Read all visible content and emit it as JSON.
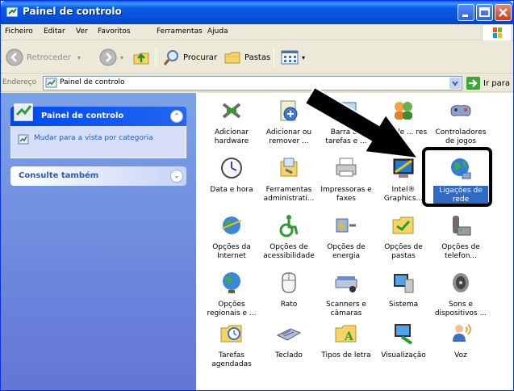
{
  "window": {
    "title": "Painel de controlo",
    "colors": {
      "titlebar": "#0551DB",
      "taskpane": "#6D8CDC",
      "selection": "#316AC5"
    }
  },
  "menu": {
    "items": [
      "Ficheiro",
      "Editar",
      "Ver",
      "Favoritos",
      "Ferramentas",
      "Ajuda"
    ]
  },
  "toolbar": {
    "back": "Retroceder",
    "search": "Procurar",
    "folders": "Pastas"
  },
  "address": {
    "label": "Endereço",
    "value": "Painel de controlo",
    "go": "Ir para"
  },
  "taskpane": {
    "panel1": {
      "title": "Painel de controlo",
      "link": "Mudar para a vista por categoria"
    },
    "panel2": {
      "title": "Consulte também"
    }
  },
  "items": [
    {
      "label": "Adicionar hardware",
      "icon": "hardware-icon"
    },
    {
      "label": "Adicionar ou remover ...",
      "icon": "add-remove-icon"
    },
    {
      "label": "Barra de tarefas e ...",
      "icon": "taskbar-icon"
    },
    {
      "label": "... s de ... res",
      "icon": "accounts-icon"
    },
    {
      "label": "Controladores de jogos",
      "icon": "gamepad-icon"
    },
    {
      "label": "Data e hora",
      "icon": "clock-icon"
    },
    {
      "label": "Ferramentas administrati...",
      "icon": "admin-tools-icon"
    },
    {
      "label": "Impressoras e faxes",
      "icon": "printer-icon"
    },
    {
      "label": "Intel® Graphics...",
      "icon": "intel-graphics-icon"
    },
    {
      "label": "Ligações de rede",
      "icon": "network-globe-icon",
      "selected": true
    },
    {
      "label": "Opções da Internet",
      "icon": "internet-globe-icon"
    },
    {
      "label": "Opções de acessibilidade",
      "icon": "accessibility-icon"
    },
    {
      "label": "Opções de energia",
      "icon": "power-icon"
    },
    {
      "label": "Opções de pastas",
      "icon": "folder-options-icon"
    },
    {
      "label": "Opções de telefon...",
      "icon": "phone-modem-icon"
    },
    {
      "label": "Opções regionais e ...",
      "icon": "regional-globe-icon"
    },
    {
      "label": "Rato",
      "icon": "mouse-icon"
    },
    {
      "label": "Scanners e câmaras",
      "icon": "scanner-icon"
    },
    {
      "label": "Sistema",
      "icon": "system-icon"
    },
    {
      "label": "Sons e dispositivos ...",
      "icon": "speaker-icon"
    },
    {
      "label": "Tarefas agendadas",
      "icon": "scheduled-tasks-icon"
    },
    {
      "label": "Teclado",
      "icon": "keyboard-icon"
    },
    {
      "label": "Tipos de letra",
      "icon": "fonts-folder-icon"
    },
    {
      "label": "Visualização",
      "icon": "display-icon"
    },
    {
      "label": "Voz",
      "icon": "speech-icon"
    }
  ]
}
